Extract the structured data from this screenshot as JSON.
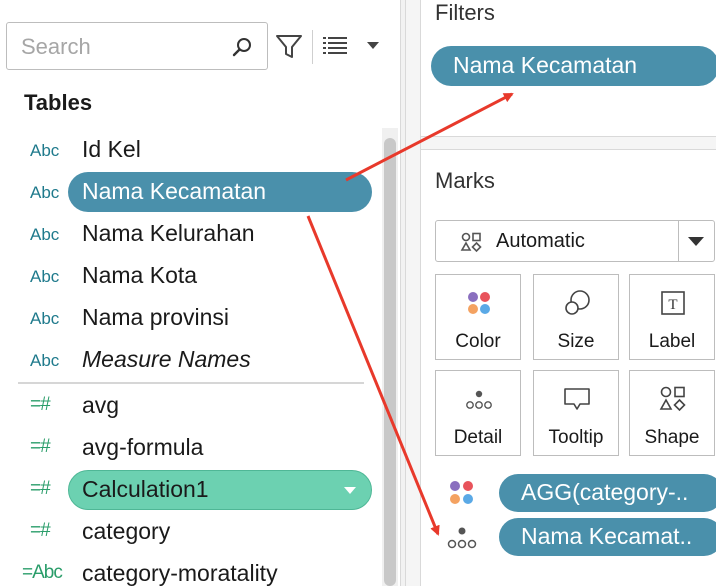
{
  "search": {
    "placeholder": "Search"
  },
  "data_pane": {
    "title": "Tables",
    "fields": [
      {
        "type": "Abc",
        "name": "Id Kel"
      },
      {
        "type": "Abc",
        "name": "Nama Kecamatan"
      },
      {
        "type": "Abc",
        "name": "Nama Kelurahan"
      },
      {
        "type": "Abc",
        "name": "Nama Kota"
      },
      {
        "type": "Abc",
        "name": "Nama provinsi"
      },
      {
        "type": "Abc",
        "name": "Measure Names"
      },
      {
        "type": "=#",
        "name": "avg"
      },
      {
        "type": "=#",
        "name": "avg-formula"
      },
      {
        "type": "=#",
        "name": "Calculation1"
      },
      {
        "type": "=#",
        "name": "category"
      },
      {
        "type": "=Abc",
        "name": "category-moratality"
      }
    ]
  },
  "filters": {
    "title": "Filters",
    "pill": "Nama Kecamatan"
  },
  "marks": {
    "title": "Marks",
    "mark_type": "Automatic",
    "buttons": [
      "Color",
      "Size",
      "Label",
      "Detail",
      "Tooltip",
      "Shape"
    ],
    "encodings": [
      {
        "icon": "color-icon",
        "label": "AGG(category-.."
      },
      {
        "icon": "detail-icon",
        "label": "Nama Kecamat.."
      }
    ]
  },
  "colors": {
    "dimension_pill": "#4a90ab",
    "measure_pill": "#6cd1b1",
    "annotation_arrow": "#e8392b"
  }
}
